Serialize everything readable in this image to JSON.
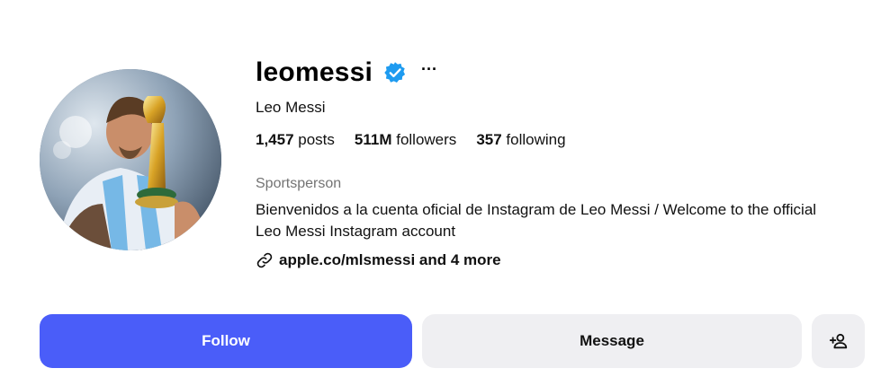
{
  "profile": {
    "username": "leomessi",
    "full_name": "Leo Messi",
    "verified_icon": "verified-badge-icon",
    "more_label": "···",
    "stats": {
      "posts_count": "1,457",
      "posts_label": " posts",
      "followers_count": "511M",
      "followers_label": " followers",
      "following_count": "357",
      "following_label": " following"
    },
    "category": "Sportsperson",
    "bio": "Bienvenidos a la cuenta oficial de Instagram de Leo Messi / Welcome to the official Leo Messi Instagram account",
    "link_text": "apple.co/mlsmessi and 4 more",
    "avatar_alt": "leomessi profile picture"
  },
  "actions": {
    "follow_label": "Follow",
    "message_label": "Message",
    "add_user_icon": "add-person-icon"
  },
  "colors": {
    "follow_button": "#4a5df9",
    "secondary_button": "#efeff2",
    "verified_badge": "#1e9bf0",
    "muted_text": "#737373"
  }
}
